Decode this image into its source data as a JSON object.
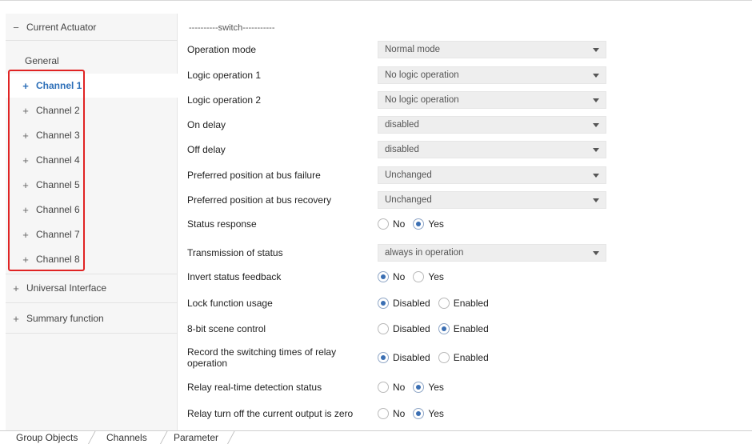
{
  "sidebar": {
    "root": {
      "glyph": "−",
      "label": "Current Actuator"
    },
    "general": "General",
    "channels": [
      {
        "glyph": "+",
        "label": "Channel 1",
        "selected": true
      },
      {
        "glyph": "+",
        "label": "Channel 2"
      },
      {
        "glyph": "+",
        "label": "Channel 3"
      },
      {
        "glyph": "+",
        "label": "Channel 4"
      },
      {
        "glyph": "+",
        "label": "Channel 5"
      },
      {
        "glyph": "+",
        "label": "Channel 6"
      },
      {
        "glyph": "+",
        "label": "Channel 7"
      },
      {
        "glyph": "+",
        "label": "Channel 8"
      }
    ],
    "universal": {
      "glyph": "+",
      "label": "Universal Interface"
    },
    "summary": {
      "glyph": "+",
      "label": "Summary function"
    }
  },
  "main": {
    "section_header": "----------switch-----------",
    "params": [
      {
        "label": "Operation mode",
        "type": "select",
        "value": "Normal mode"
      },
      {
        "label": "Logic operation 1",
        "type": "select",
        "value": "No logic operation"
      },
      {
        "label": "Logic operation 2",
        "type": "select",
        "value": "No logic operation"
      },
      {
        "label": "On delay",
        "type": "select",
        "value": "disabled"
      },
      {
        "label": "Off delay",
        "type": "select",
        "value": "disabled"
      },
      {
        "label": "Preferred position at bus failure",
        "type": "select",
        "value": "Unchanged"
      },
      {
        "label": "Preferred position at bus recovery",
        "type": "select",
        "value": "Unchanged"
      },
      {
        "label": "Status response",
        "type": "radio",
        "options": [
          "No",
          "Yes"
        ],
        "selected": 1
      },
      {
        "label": "Transmission of status",
        "type": "select",
        "value": "always in operation"
      },
      {
        "label": "Invert status feedback",
        "type": "radio",
        "options": [
          "No",
          "Yes"
        ],
        "selected": 0
      },
      {
        "label": "Lock function usage",
        "type": "radio",
        "options": [
          "Disabled",
          "Enabled"
        ],
        "selected": 0
      },
      {
        "label": "8-bit scene control",
        "type": "radio",
        "options": [
          "Disabled",
          "Enabled"
        ],
        "selected": 1
      },
      {
        "label": "Record the switching times of relay operation",
        "type": "radio",
        "options": [
          "Disabled",
          "Enabled"
        ],
        "selected": 0
      },
      {
        "label": "Relay real-time detection status",
        "type": "radio",
        "options": [
          "No",
          "Yes"
        ],
        "selected": 1
      },
      {
        "label": "Relay turn off the current output is zero",
        "type": "radio",
        "options": [
          "No",
          "Yes"
        ],
        "selected": 1
      }
    ]
  },
  "tabs": [
    "Group Objects",
    "Channels",
    "Parameter"
  ],
  "colors": {
    "selected_text": "#2d6fb8",
    "highlight_border": "#e02424",
    "radio_dot": "#3b6fb3"
  }
}
